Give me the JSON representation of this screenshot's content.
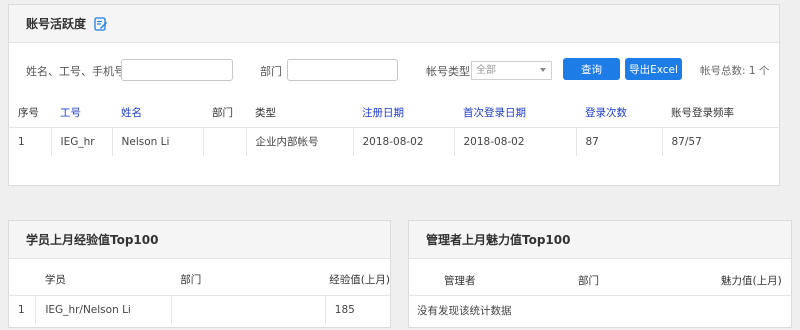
{
  "activity": {
    "title": "账号活跃度",
    "icon": "edit-icon",
    "filters": {
      "name_label": "姓名、工号、手机号",
      "dept_label": "部门",
      "type_label": "帐号类型",
      "type_value": "全部",
      "query_label": "查询",
      "export_label": "导出Excel",
      "total": "帐号总数: 1 个"
    },
    "columns": [
      "序号",
      "工号",
      "姓名",
      "部门",
      "类型",
      "注册日期",
      "首次登录日期",
      "登录次数",
      "账号登录频率"
    ],
    "rows": [
      [
        "1",
        "IEG_hr",
        "Nelson Li",
        "",
        "企业内部帐号",
        "2018-08-02",
        "2018-08-02",
        "87",
        "87/57"
      ]
    ]
  },
  "exp": {
    "title": "学员上月经验值Top100",
    "columns": [
      "",
      "学员",
      "部门",
      "经验值(上月)"
    ],
    "rows": [
      [
        "1",
        "IEG_hr/Nelson Li",
        "",
        "185"
      ]
    ]
  },
  "charm": {
    "title": "管理者上月魅力值Top100",
    "columns": [
      "管理者",
      "部门",
      "魅力值(上月)"
    ],
    "empty": "没有发现该统计数据"
  },
  "colors": {
    "accent": "#1e7ce6",
    "header_link": "#1f3bc9"
  }
}
